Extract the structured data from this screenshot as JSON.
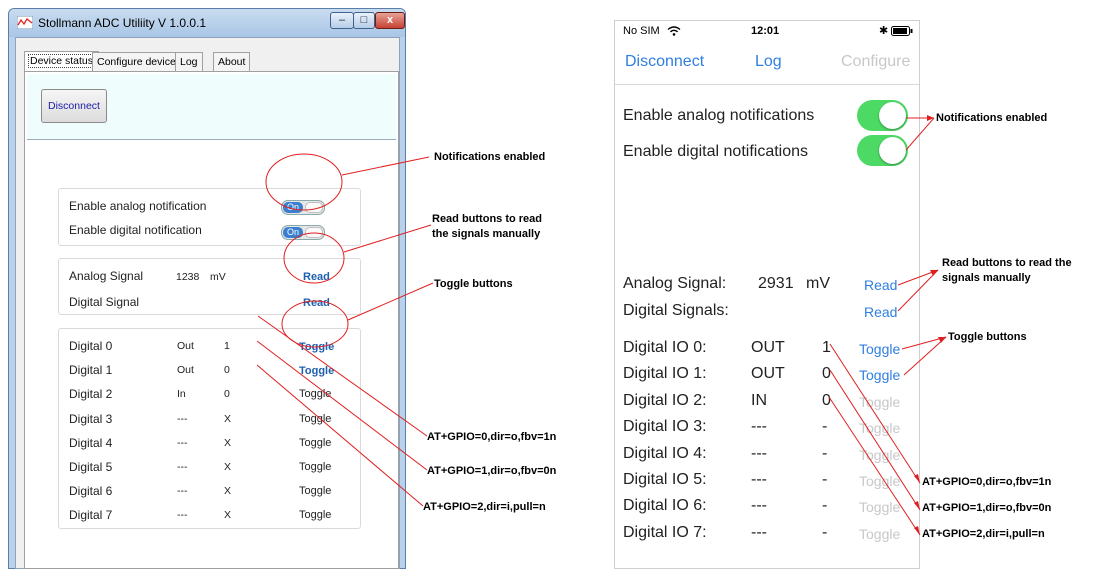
{
  "windows_app": {
    "title": "Stollmann ADC Utiliity V 1.0.0.1",
    "window_buttons": {
      "minimize": "–",
      "maximize": "□",
      "close": "x"
    },
    "tabs": [
      {
        "label": "Device status",
        "selected": true
      },
      {
        "label": "Configure device"
      },
      {
        "label": "Log"
      },
      {
        "label": "About"
      }
    ],
    "disconnect_label": "Disconnect",
    "notifications": [
      {
        "label": "Enable analog notification",
        "switch": "On"
      },
      {
        "label": "Enable digital notification",
        "switch": "On"
      }
    ],
    "signals": [
      {
        "label": "Analog Signal",
        "value": "1238",
        "unit": "mV",
        "button": "Read"
      },
      {
        "label": "Digital Signal",
        "button": "Read"
      }
    ],
    "digital_rows": [
      {
        "label": "Digital 0",
        "dir": "Out",
        "value": "1",
        "button": "Toggle"
      },
      {
        "label": "Digital 1",
        "dir": "Out",
        "value": "0",
        "button": "Toggle"
      },
      {
        "label": "Digital 2",
        "dir": "In",
        "value": "0",
        "button": "Toggle"
      },
      {
        "label": "Digital 3",
        "dir": "---",
        "value": "X",
        "button": "Toggle"
      },
      {
        "label": "Digital 4",
        "dir": "---",
        "value": "X",
        "button": "Toggle"
      },
      {
        "label": "Digital 5",
        "dir": "---",
        "value": "X",
        "button": "Toggle"
      },
      {
        "label": "Digital 6",
        "dir": "---",
        "value": "X",
        "button": "Toggle"
      },
      {
        "label": "Digital 7",
        "dir": "---",
        "value": "X",
        "button": "Toggle"
      }
    ]
  },
  "phone": {
    "status": {
      "carrier": "No SIM",
      "time": "12:01",
      "bluetooth": "✱"
    },
    "nav": {
      "left": "Disconnect",
      "center": "Log",
      "right": "Configure"
    },
    "notifications": [
      {
        "label": "Enable analog notifications",
        "on": true
      },
      {
        "label": "Enable digital notifications",
        "on": true
      }
    ],
    "analog": {
      "label": "Analog Signal:",
      "value": "2931",
      "unit": "mV",
      "button": "Read"
    },
    "digital_signals": {
      "label": "Digital Signals:",
      "button": "Read"
    },
    "io_rows": [
      {
        "label": "Digital IO 0:",
        "dir": "OUT",
        "value": "1",
        "button": "Toggle",
        "enabled": true
      },
      {
        "label": "Digital IO 1:",
        "dir": "OUT",
        "value": "0",
        "button": "Toggle",
        "enabled": true
      },
      {
        "label": "Digital IO 2:",
        "dir": "IN",
        "value": "0",
        "button": "Toggle",
        "enabled": false
      },
      {
        "label": "Digital IO 3:",
        "dir": "---",
        "value": "-",
        "button": "Toggle",
        "enabled": false
      },
      {
        "label": "Digital IO 4:",
        "dir": "---",
        "value": "-",
        "button": "Toggle",
        "enabled": false
      },
      {
        "label": "Digital IO 5:",
        "dir": "---",
        "value": "-",
        "button": "Toggle",
        "enabled": false
      },
      {
        "label": "Digital IO 6:",
        "dir": "---",
        "value": "-",
        "button": "Toggle",
        "enabled": false
      },
      {
        "label": "Digital IO 7:",
        "dir": "---",
        "value": "-",
        "button": "Toggle",
        "enabled": false
      }
    ]
  },
  "annotations": {
    "left_notifications": "Notifications enabled",
    "left_read": [
      "Read buttons to read",
      "the signals manually"
    ],
    "left_toggle": "Toggle buttons",
    "left_gpio": [
      "AT+GPIO=0,dir=o,fbv=1n",
      "AT+GPIO=1,dir=o,fbv=0n",
      "AT+GPIO=2,dir=i,pull=n"
    ],
    "right_notifications": "Notifications enabled",
    "right_read": [
      "Read buttons to read the",
      "signals manually"
    ],
    "right_toggle": "Toggle buttons",
    "right_gpio": [
      "AT+GPIO=0,dir=o,fbv=1n",
      "AT+GPIO=1,dir=o,fbv=0n",
      "AT+GPIO=2,dir=i,pull=n"
    ]
  },
  "colors": {
    "annotation_red": "#e02020",
    "ios_blue": "#2f7fe0",
    "ios_green": "#4cd964",
    "win_link": "#1e5fae"
  }
}
